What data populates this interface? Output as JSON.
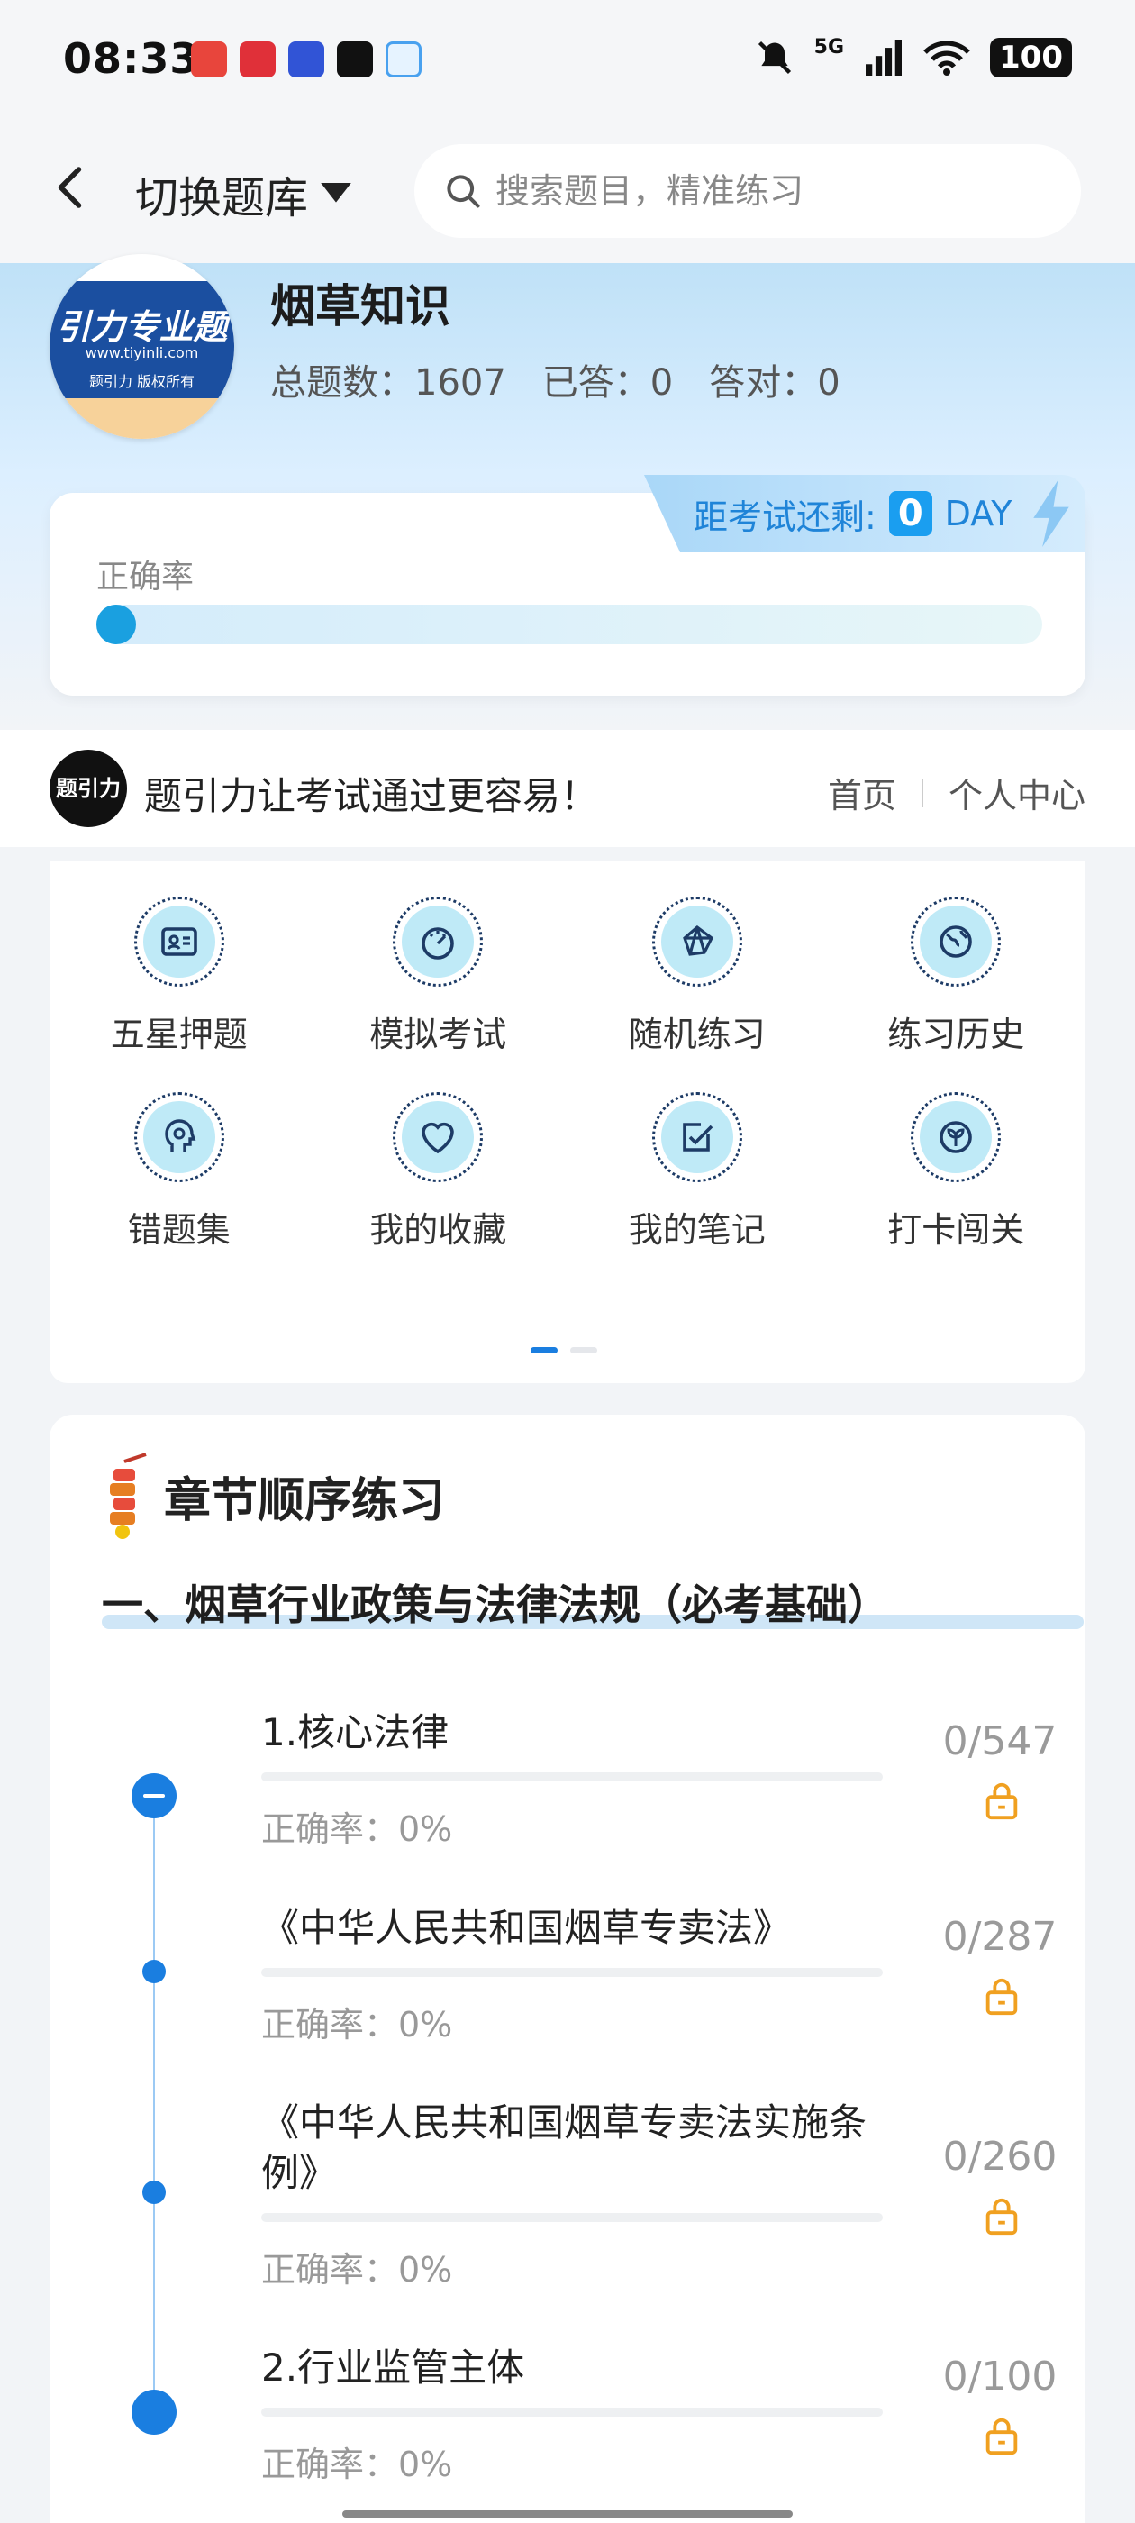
{
  "status_bar": {
    "time": "08:33",
    "network": "5G",
    "battery": "100",
    "notification_icons": [
      "app-notification-1",
      "xiaohongshu-notification",
      "app-notification-3",
      "tiktok-notification",
      "app-notification-5"
    ],
    "notification_colors": [
      "#e8453c",
      "#e03039",
      "#3154d6",
      "#111111",
      "#49a1ef"
    ]
  },
  "header": {
    "back_icon": "chevron-left-icon",
    "switch_label": "切换题库",
    "search_placeholder": "搜索题目，精准练习"
  },
  "subject": {
    "logo_text": "引力专业题",
    "logo_url": "www.tiyinli.com",
    "logo_rights": "题引力 版权所有",
    "title": "烟草知识",
    "total_label": "总题数：1607",
    "answered_label": "已答：0",
    "correct_label": "答对：0"
  },
  "accuracy_card": {
    "label": "正确率",
    "progress_percent": 0,
    "countdown_label": "距考试还剩:",
    "countdown_value": "0",
    "countdown_unit": "DAY"
  },
  "banner": {
    "logo_text": "题引力",
    "text": "题引力让考试通过更容易！",
    "home_link": "首页",
    "profile_link": "个人中心"
  },
  "feature_grid": [
    {
      "label": "五星押题",
      "icon": "id-card-icon"
    },
    {
      "label": "模拟考试",
      "icon": "speedometer-icon"
    },
    {
      "label": "随机练习",
      "icon": "network-icon"
    },
    {
      "label": "练习历史",
      "icon": "globe-icon"
    },
    {
      "label": "错题集",
      "icon": "head-icon"
    },
    {
      "label": "我的收藏",
      "icon": "heart-icon"
    },
    {
      "label": "我的笔记",
      "icon": "note-check-icon"
    },
    {
      "label": "打卡闯关",
      "icon": "leaf-icon"
    }
  ],
  "chapter": {
    "heading": "章节顺序练习",
    "section_title": "一、烟草行业政策与法律法规（必考基础）",
    "items": [
      {
        "name": "1.核心法律",
        "accuracy": "正确率：0%",
        "count": "0/547"
      },
      {
        "name": "《中华人民共和国烟草专卖法》",
        "accuracy": "正确率：0%",
        "count": "0/287"
      },
      {
        "name": "《中华人民共和国烟草专卖法实施条例》",
        "accuracy": "正确率：0%",
        "count": "0/260"
      },
      {
        "name": "2.行业监管主体",
        "accuracy": "正确率：0%",
        "count": "0/100"
      }
    ]
  },
  "colors": {
    "accent": "#1a7ee0",
    "lock": "#f0a020"
  }
}
